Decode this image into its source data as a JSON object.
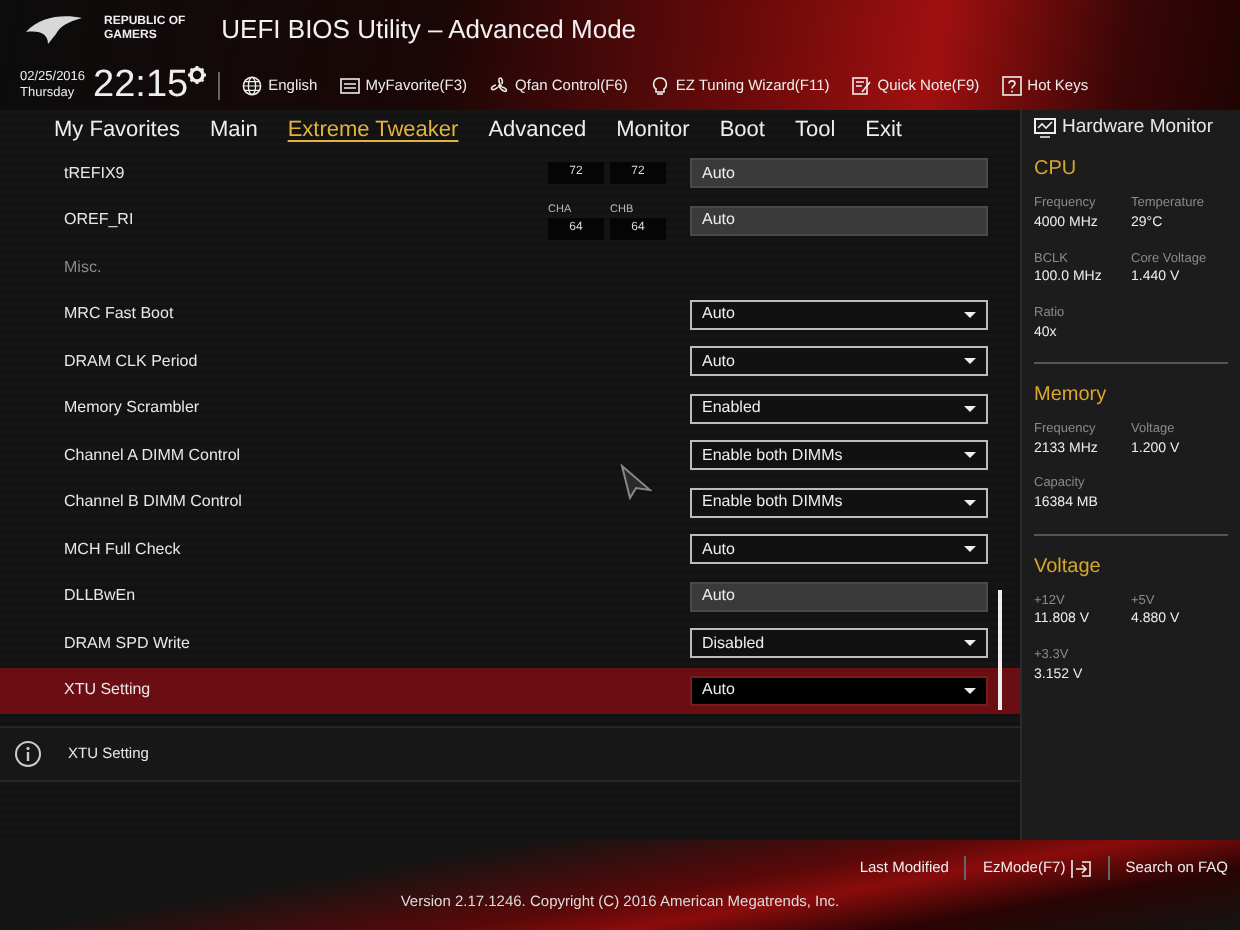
{
  "header": {
    "brand": [
      "REPUBLIC OF",
      "GAMERS"
    ],
    "title": "UEFI BIOS Utility – Advanced Mode"
  },
  "clock": {
    "date": "02/25/2016",
    "day": "Thursday",
    "time": "22:15"
  },
  "toolbar": [
    {
      "kind": "globe",
      "label": "English"
    },
    {
      "kind": "favorite",
      "label": "MyFavorite(F3)"
    },
    {
      "kind": "fan",
      "label": "Qfan Control(F6)"
    },
    {
      "kind": "bulb",
      "label": "EZ Tuning Wizard(F11)"
    },
    {
      "kind": "note",
      "label": "Quick Note(F9)"
    },
    {
      "kind": "help",
      "label": "Hot Keys"
    }
  ],
  "tabs": [
    {
      "label": "My Favorites",
      "selected": false
    },
    {
      "label": "Main",
      "selected": false
    },
    {
      "label": "Extreme Tweaker",
      "selected": true
    },
    {
      "label": "Advanced",
      "selected": false
    },
    {
      "label": "Monitor",
      "selected": false
    },
    {
      "label": "Boot",
      "selected": false
    },
    {
      "label": "Tool",
      "selected": false
    },
    {
      "label": "Exit",
      "selected": false
    }
  ],
  "settings": [
    {
      "kind": "field",
      "label": "tREFIX9",
      "channels": [
        {
          "value": "72"
        },
        {
          "value": "72"
        }
      ],
      "value": "Auto",
      "selected": false
    },
    {
      "kind": "field",
      "label": "OREF_RI",
      "channels": [
        {
          "name": "CHA",
          "value": "64"
        },
        {
          "name": "CHB",
          "value": "64"
        }
      ],
      "value": "Auto",
      "selected": false
    },
    {
      "kind": "header",
      "label": "Misc."
    },
    {
      "kind": "dropdown",
      "label": "MRC Fast Boot",
      "value": "Auto",
      "selected": false
    },
    {
      "kind": "dropdown",
      "label": "DRAM CLK Period",
      "value": "Auto",
      "selected": false
    },
    {
      "kind": "dropdown",
      "label": "Memory Scrambler",
      "value": "Enabled",
      "selected": false
    },
    {
      "kind": "dropdown",
      "label": "Channel A DIMM Control",
      "value": "Enable both DIMMs",
      "selected": false
    },
    {
      "kind": "dropdown",
      "label": "Channel B DIMM Control",
      "value": "Enable both DIMMs",
      "selected": false
    },
    {
      "kind": "dropdown",
      "label": "MCH Full Check",
      "value": "Auto",
      "selected": false
    },
    {
      "kind": "field",
      "label": "DLLBwEn",
      "value": "Auto",
      "selected": false
    },
    {
      "kind": "dropdown",
      "label": "DRAM SPD Write",
      "value": "Disabled",
      "selected": false
    },
    {
      "kind": "dropdown",
      "label": "XTU Setting",
      "value": "Auto",
      "selected": true
    }
  ],
  "help_text": "XTU Setting",
  "hardware_monitor": {
    "title": "Hardware Monitor",
    "sections": [
      {
        "name": "CPU",
        "items": [
          {
            "label": "Frequency",
            "value": "4000 MHz"
          },
          {
            "label": "Temperature",
            "value": "29°C"
          },
          {
            "label": "BCLK",
            "value": "100.0 MHz"
          },
          {
            "label": "Core Voltage",
            "value": "1.440 V"
          },
          {
            "label": "Ratio",
            "value": "40x"
          }
        ]
      },
      {
        "name": "Memory",
        "items": [
          {
            "label": "Frequency",
            "value": "2133 MHz"
          },
          {
            "label": "Voltage",
            "value": "1.200 V"
          },
          {
            "label": "Capacity",
            "value": "16384 MB"
          }
        ]
      },
      {
        "name": "Voltage",
        "items": [
          {
            "label": "+12V",
            "value": "11.808 V"
          },
          {
            "label": "+5V",
            "value": "4.880 V"
          },
          {
            "label": "+3.3V",
            "value": "3.152 V"
          }
        ]
      }
    ]
  },
  "footer": {
    "links": [
      "Last Modified",
      "EzMode(F7)",
      "Search on FAQ"
    ],
    "version": "Version 2.17.1246. Copyright (C) 2016 American Megatrends, Inc."
  }
}
